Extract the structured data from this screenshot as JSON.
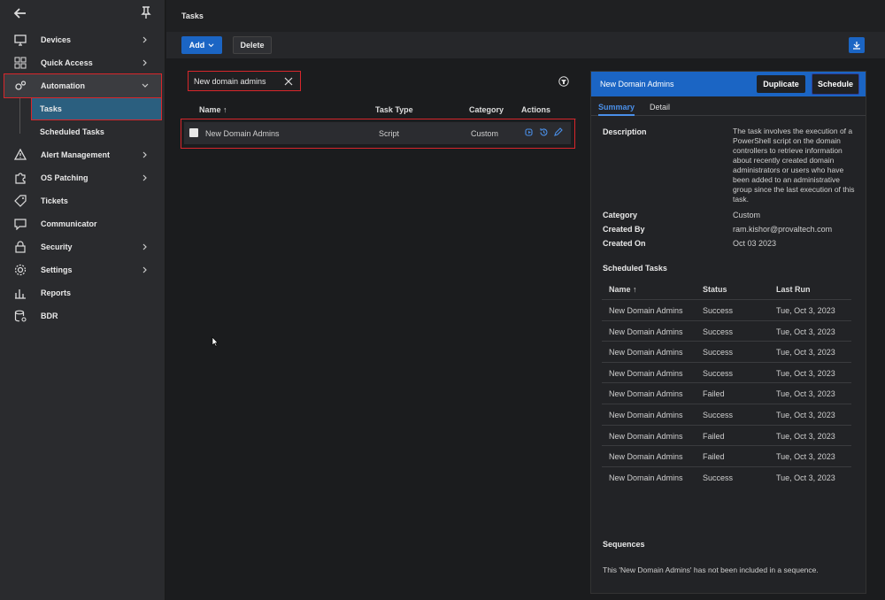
{
  "sidebar": {
    "items": [
      {
        "label": "Devices",
        "icon": "monitor-icon",
        "has_chevron": true
      },
      {
        "label": "Quick Access",
        "icon": "grid-icon",
        "has_chevron": true
      },
      {
        "label": "Automation",
        "icon": "gears-icon",
        "has_chevron": true,
        "expanded": true
      },
      {
        "label": "Alert Management",
        "icon": "warning-icon",
        "has_chevron": true
      },
      {
        "label": "OS Patching",
        "icon": "puzzle-icon",
        "has_chevron": true
      },
      {
        "label": "Tickets",
        "icon": "tag-icon",
        "has_chevron": false
      },
      {
        "label": "Communicator",
        "icon": "chat-icon",
        "has_chevron": false
      },
      {
        "label": "Security",
        "icon": "lock-icon",
        "has_chevron": true
      },
      {
        "label": "Settings",
        "icon": "gear-icon",
        "has_chevron": true
      },
      {
        "label": "Reports",
        "icon": "bar-chart-icon",
        "has_chevron": false
      },
      {
        "label": "BDR",
        "icon": "database-icon",
        "has_chevron": false
      }
    ],
    "sub_items": [
      "Tasks",
      "Scheduled Tasks"
    ]
  },
  "header": {
    "title": "Tasks"
  },
  "toolbar": {
    "add_label": "Add",
    "delete_label": "Delete"
  },
  "search": {
    "value": "New domain admins"
  },
  "list": {
    "columns": [
      "Name",
      "Task Type",
      "Category",
      "Actions"
    ],
    "rows": [
      {
        "name": "New Domain Admins",
        "type": "Script",
        "category": "Custom"
      }
    ]
  },
  "detail": {
    "title": "New Domain Admins",
    "duplicate_label": "Duplicate",
    "schedule_label": "Schedule",
    "tabs": [
      "Summary",
      "Detail"
    ],
    "description_label": "Description",
    "description": "The task involves the execution of a PowerShell script on the domain controllers to retrieve information about recently created domain administrators or users who have been added to an administrative group since the last execution of this task.",
    "category_label": "Category",
    "category": "Custom",
    "created_by_label": "Created By",
    "created_by": "ram.kishor@provaltech.com",
    "created_on_label": "Created On",
    "created_on": "Oct 03 2023",
    "scheduled_title": "Scheduled Tasks",
    "scheduled_columns": [
      "Name",
      "Status",
      "Last Run"
    ],
    "scheduled_rows": [
      {
        "name": "New Domain Admins",
        "status": "Success",
        "last_run": "Tue, Oct 3, 2023"
      },
      {
        "name": "New Domain Admins",
        "status": "Success",
        "last_run": "Tue, Oct 3, 2023"
      },
      {
        "name": "New Domain Admins",
        "status": "Success",
        "last_run": "Tue, Oct 3, 2023"
      },
      {
        "name": "New Domain Admins",
        "status": "Success",
        "last_run": "Tue, Oct 3, 2023"
      },
      {
        "name": "New Domain Admins",
        "status": "Failed",
        "last_run": "Tue, Oct 3, 2023"
      },
      {
        "name": "New Domain Admins",
        "status": "Success",
        "last_run": "Tue, Oct 3, 2023"
      },
      {
        "name": "New Domain Admins",
        "status": "Failed",
        "last_run": "Tue, Oct 3, 2023"
      },
      {
        "name": "New Domain Admins",
        "status": "Failed",
        "last_run": "Tue, Oct 3, 2023"
      },
      {
        "name": "New Domain Admins",
        "status": "Success",
        "last_run": "Tue, Oct 3, 2023"
      }
    ],
    "sequences_title": "Sequences",
    "sequences_note": "This 'New Domain Admins' has not been included in a sequence."
  },
  "colors": {
    "accent": "#1b65c4",
    "highlight": "#d8262b",
    "active_sub": "#2b5f7f"
  }
}
